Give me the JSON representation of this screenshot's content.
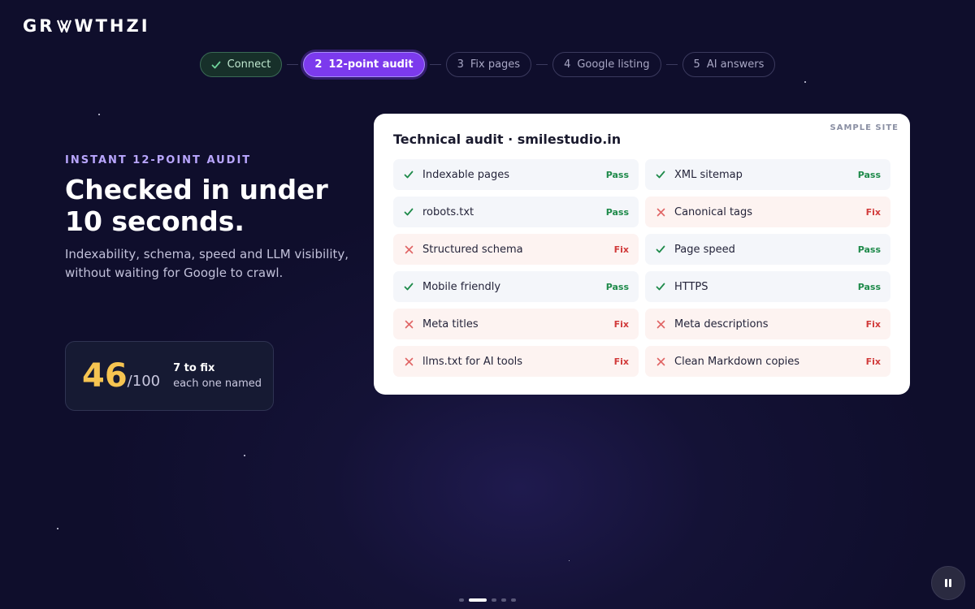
{
  "brand": {
    "logo_text": "GROWTHZI"
  },
  "steps": [
    {
      "num": "",
      "label": "Connect",
      "state": "done"
    },
    {
      "num": "2",
      "label": "12-point audit",
      "state": "active"
    },
    {
      "num": "3",
      "label": "Fix pages",
      "state": "pending"
    },
    {
      "num": "4",
      "label": "Google listing",
      "state": "pending"
    },
    {
      "num": "5",
      "label": "AI answers",
      "state": "pending"
    }
  ],
  "hero": {
    "eyebrow": "INSTANT 12-POINT AUDIT",
    "headline": "Checked in under 10 seconds.",
    "subtext": "Indexability, schema, speed and LLM visibility, without waiting for Google to crawl."
  },
  "score": {
    "value": "46",
    "denominator": "/100",
    "to_fix": "7 to fix",
    "note": "each one named"
  },
  "audit": {
    "tag": "SAMPLE SITE",
    "title": "Technical audit · smilestudio.in",
    "items": [
      {
        "label": "Indexable pages",
        "status": "Pass",
        "result": "pass"
      },
      {
        "label": "XML sitemap",
        "status": "Pass",
        "result": "pass"
      },
      {
        "label": "robots.txt",
        "status": "Pass",
        "result": "pass"
      },
      {
        "label": "Canonical tags",
        "status": "Fix",
        "result": "fix"
      },
      {
        "label": "Structured schema",
        "status": "Fix",
        "result": "fix"
      },
      {
        "label": "Page speed",
        "status": "Pass",
        "result": "pass"
      },
      {
        "label": "Mobile friendly",
        "status": "Pass",
        "result": "pass"
      },
      {
        "label": "HTTPS",
        "status": "Pass",
        "result": "pass"
      },
      {
        "label": "Meta titles",
        "status": "Fix",
        "result": "fix"
      },
      {
        "label": "Meta descriptions",
        "status": "Fix",
        "result": "fix"
      },
      {
        "label": "llms.txt for AI tools",
        "status": "Fix",
        "result": "fix"
      },
      {
        "label": "Clean Markdown copies",
        "status": "Fix",
        "result": "fix"
      }
    ]
  },
  "carousel": {
    "slide_count": 5,
    "active_index": 1
  },
  "colors": {
    "accent": "#7c3aed",
    "pass": "#1e8a4a",
    "fix": "#d13a3a",
    "score": "#f6c451"
  }
}
